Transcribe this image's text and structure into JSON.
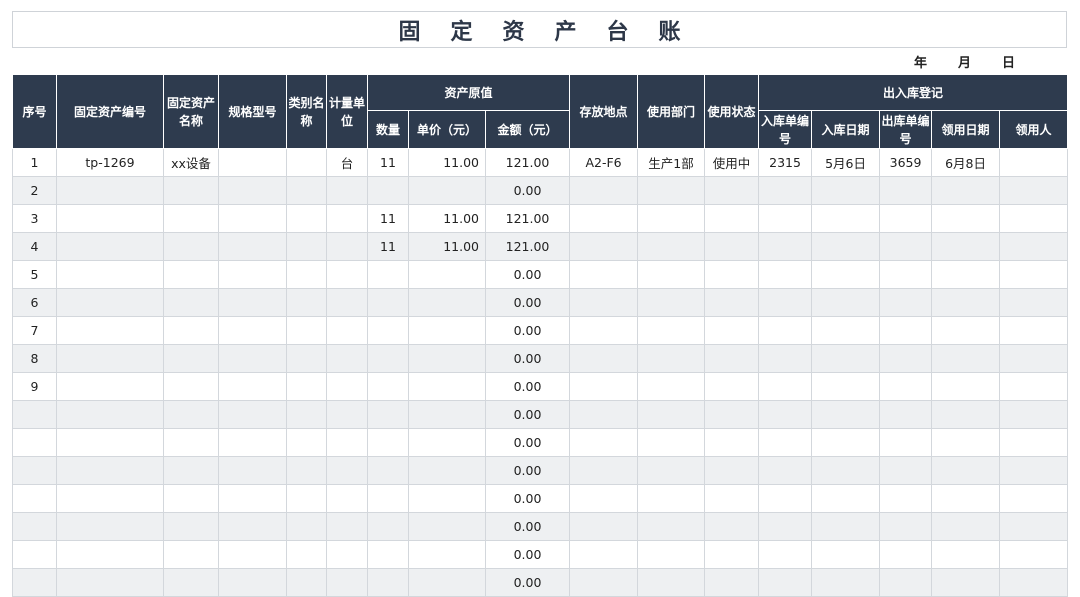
{
  "title": "固定资产台账",
  "date_labels": {
    "year": "年",
    "month": "月",
    "day": "日"
  },
  "headers": {
    "seq": "序号",
    "asset_no": "固定资产编号",
    "asset_name": "固定资产名称",
    "spec": "规格型号",
    "category": "类别名称",
    "unit": "计量单位",
    "original_value": "资产原值",
    "qty": "数量",
    "unit_price": "单价（元）",
    "amount": "金额（元）",
    "location": "存放地点",
    "dept": "使用部门",
    "status": "使用状态",
    "io_register": "出入库登记",
    "in_no": "入库单编号",
    "in_date": "入库日期",
    "out_no": "出库单编号",
    "take_date": "领用日期",
    "taker": "领用人"
  },
  "rows": [
    [
      "1",
      "tp-1269",
      "xx设备",
      "",
      "",
      "台",
      "11",
      "11.00",
      "121.00",
      "A2-F6",
      "生产1部",
      "使用中",
      "2315",
      "5月6日",
      "3659",
      "6月8日",
      ""
    ],
    [
      "2",
      "",
      "",
      "",
      "",
      "",
      "",
      "",
      "0.00",
      "",
      "",
      "",
      "",
      "",
      "",
      "",
      ""
    ],
    [
      "3",
      "",
      "",
      "",
      "",
      "",
      "11",
      "11.00",
      "121.00",
      "",
      "",
      "",
      "",
      "",
      "",
      "",
      ""
    ],
    [
      "4",
      "",
      "",
      "",
      "",
      "",
      "11",
      "11.00",
      "121.00",
      "",
      "",
      "",
      "",
      "",
      "",
      "",
      ""
    ],
    [
      "5",
      "",
      "",
      "",
      "",
      "",
      "",
      "",
      "0.00",
      "",
      "",
      "",
      "",
      "",
      "",
      "",
      ""
    ],
    [
      "6",
      "",
      "",
      "",
      "",
      "",
      "",
      "",
      "0.00",
      "",
      "",
      "",
      "",
      "",
      "",
      "",
      ""
    ],
    [
      "7",
      "",
      "",
      "",
      "",
      "",
      "",
      "",
      "0.00",
      "",
      "",
      "",
      "",
      "",
      "",
      "",
      ""
    ],
    [
      "8",
      "",
      "",
      "",
      "",
      "",
      "",
      "",
      "0.00",
      "",
      "",
      "",
      "",
      "",
      "",
      "",
      ""
    ],
    [
      "9",
      "",
      "",
      "",
      "",
      "",
      "",
      "",
      "0.00",
      "",
      "",
      "",
      "",
      "",
      "",
      "",
      ""
    ],
    [
      "",
      "",
      "",
      "",
      "",
      "",
      "",
      "",
      "0.00",
      "",
      "",
      "",
      "",
      "",
      "",
      "",
      ""
    ],
    [
      "",
      "",
      "",
      "",
      "",
      "",
      "",
      "",
      "0.00",
      "",
      "",
      "",
      "",
      "",
      "",
      "",
      ""
    ],
    [
      "",
      "",
      "",
      "",
      "",
      "",
      "",
      "",
      "0.00",
      "",
      "",
      "",
      "",
      "",
      "",
      "",
      ""
    ],
    [
      "",
      "",
      "",
      "",
      "",
      "",
      "",
      "",
      "0.00",
      "",
      "",
      "",
      "",
      "",
      "",
      "",
      ""
    ],
    [
      "",
      "",
      "",
      "",
      "",
      "",
      "",
      "",
      "0.00",
      "",
      "",
      "",
      "",
      "",
      "",
      "",
      ""
    ],
    [
      "",
      "",
      "",
      "",
      "",
      "",
      "",
      "",
      "0.00",
      "",
      "",
      "",
      "",
      "",
      "",
      "",
      ""
    ],
    [
      "",
      "",
      "",
      "",
      "",
      "",
      "",
      "",
      "0.00",
      "",
      "",
      "",
      "",
      "",
      "",
      "",
      ""
    ]
  ]
}
